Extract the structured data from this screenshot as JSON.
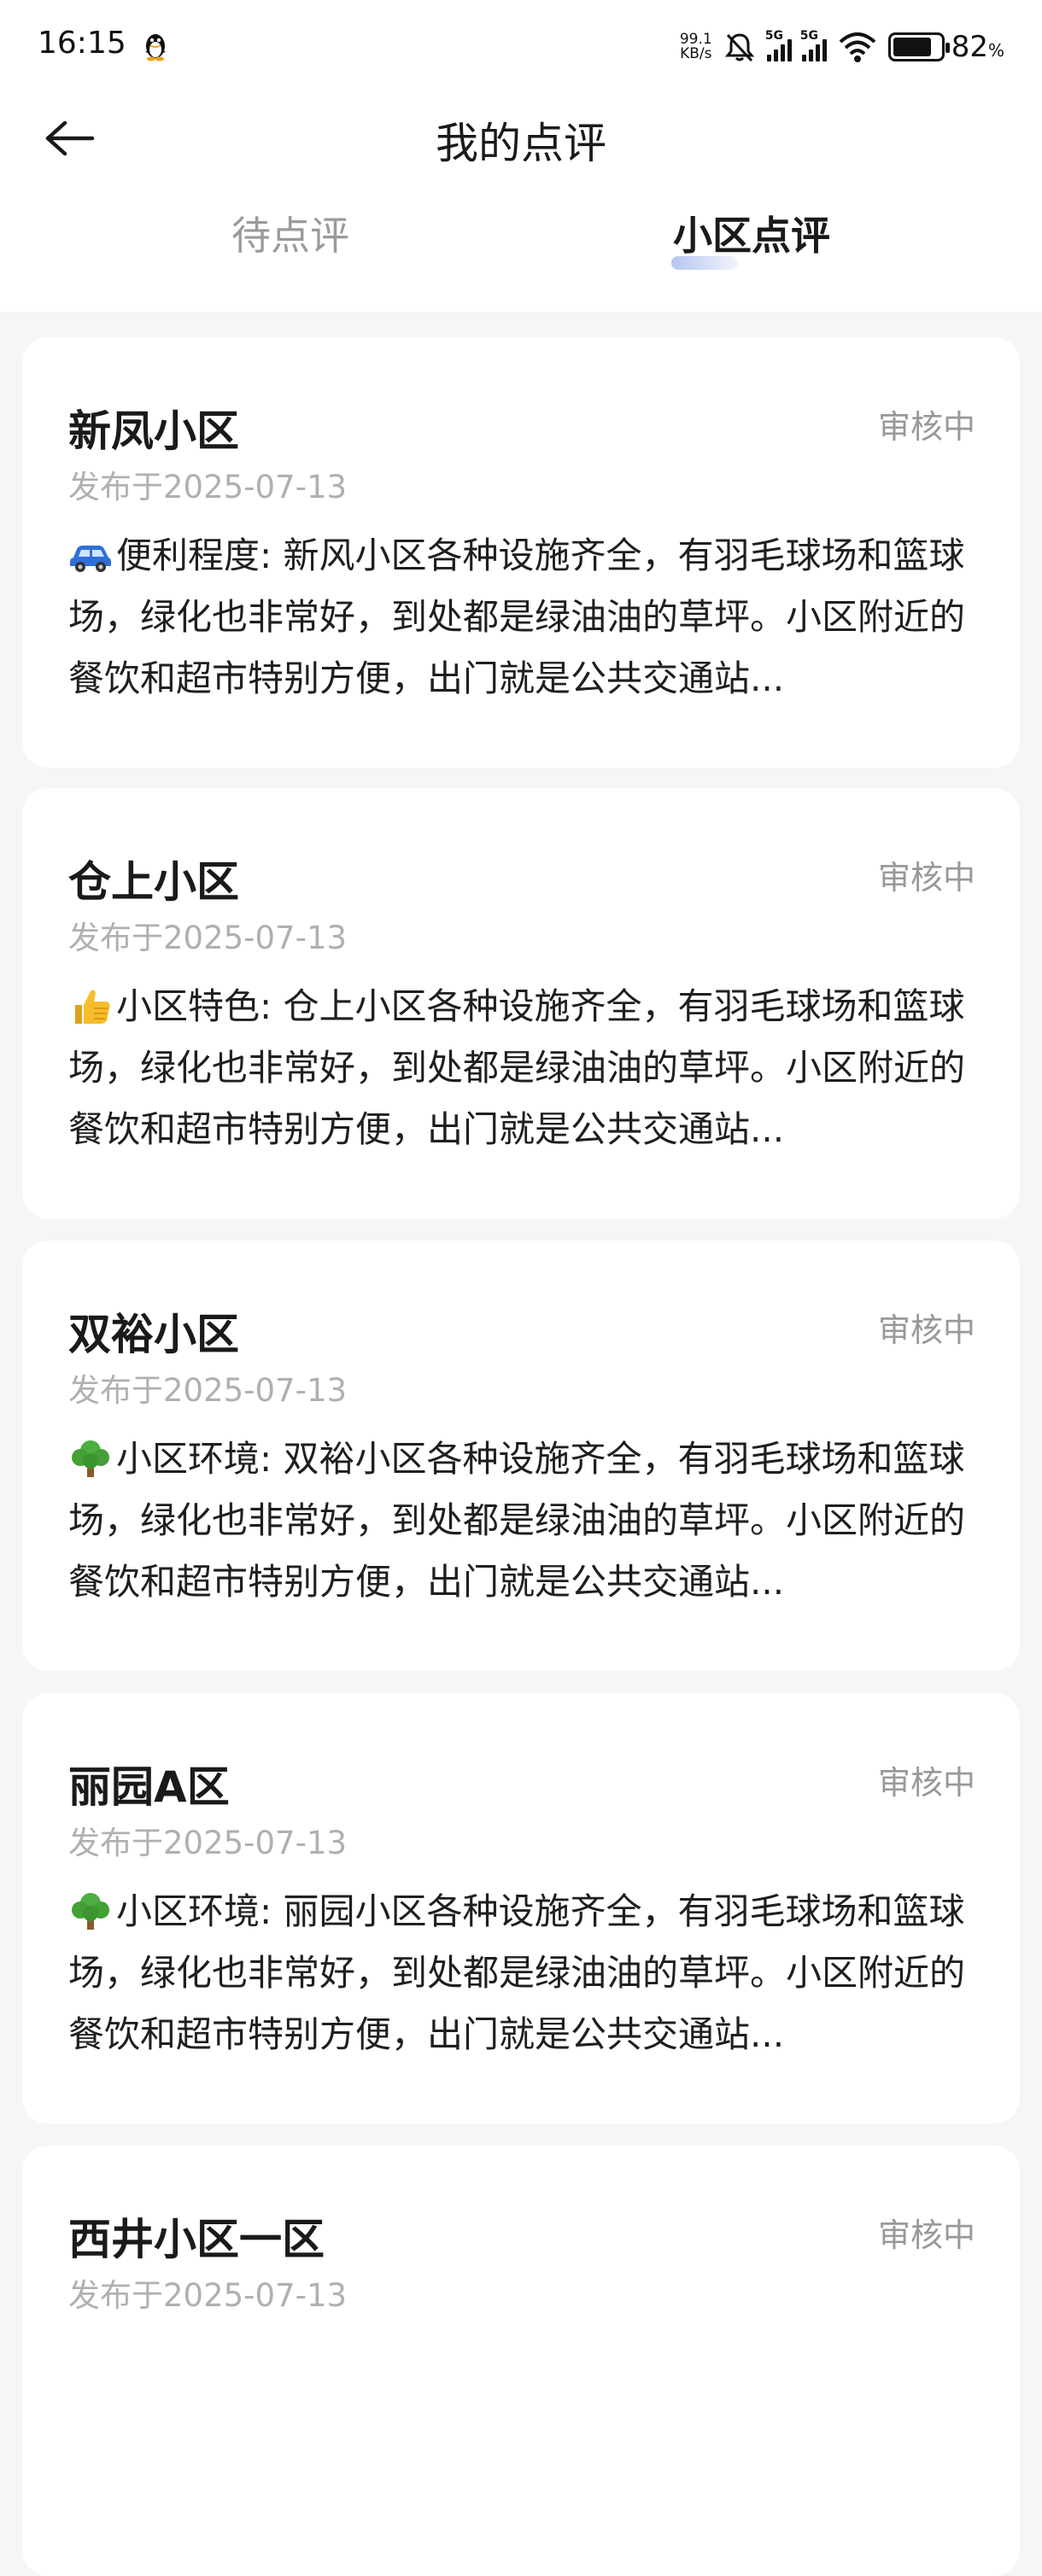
{
  "status_bar": {
    "time": "16:15",
    "net_speed_value": "99.1",
    "net_speed_unit": "KB/s",
    "signal1_label": "5G",
    "signal2_label": "5G",
    "battery_percent": "82",
    "battery_percent_symbol": "%",
    "battery_level": 0.82
  },
  "header": {
    "title": "我的点评"
  },
  "tabs": [
    {
      "label": "待点评",
      "active": false
    },
    {
      "label": "小区点评",
      "active": true
    }
  ],
  "reviews": [
    {
      "name": "新凤小区",
      "status": "审核中",
      "date": "发布于2025-07-13",
      "icon": "car-icon",
      "text": "便利程度: 新风小区各种设施齐全，有羽毛球场和篮球场，绿化也非常好，到处都是绿油油的草坪。小区附近的餐饮和超市特别方便，出门就是公共交通站..."
    },
    {
      "name": "仓上小区",
      "status": "审核中",
      "date": "发布于2025-07-13",
      "icon": "thumbs-up-icon",
      "text": "小区特色: 仓上小区各种设施齐全，有羽毛球场和篮球场，绿化也非常好，到处都是绿油油的草坪。小区附近的餐饮和超市特别方便，出门就是公共交通站..."
    },
    {
      "name": "双裕小区",
      "status": "审核中",
      "date": "发布于2025-07-13",
      "icon": "tree-icon",
      "text": "小区环境: 双裕小区各种设施齐全，有羽毛球场和篮球场，绿化也非常好，到处都是绿油油的草坪。小区附近的餐饮和超市特别方便，出门就是公共交通站..."
    },
    {
      "name": "丽园A区",
      "status": "审核中",
      "date": "发布于2025-07-13",
      "icon": "tree-icon",
      "text": "小区环境: 丽园小区各种设施齐全，有羽毛球场和篮球场，绿化也非常好，到处都是绿油油的草坪。小区附近的餐饮和超市特别方便，出门就是公共交通站..."
    },
    {
      "name": "西井小区一区",
      "status": "审核中",
      "date": "发布于2025-07-13",
      "icon": "",
      "text": ""
    }
  ]
}
